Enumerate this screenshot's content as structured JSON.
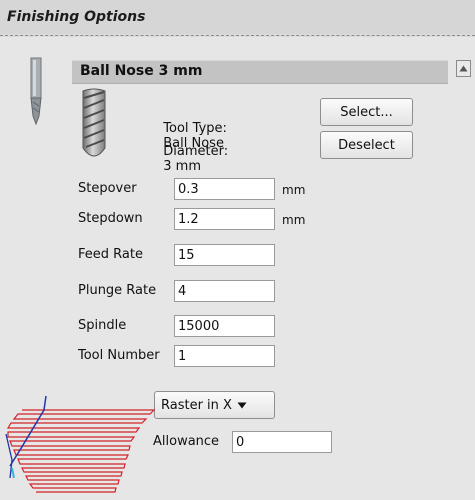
{
  "header": {
    "title": "Finishing Options"
  },
  "tool": {
    "name": "Ball Nose 3 mm",
    "type_label": "Tool Type:",
    "type_value": "Ball Nose",
    "diameter_label": "Diameter:",
    "diameter_value": "3 mm"
  },
  "buttons": {
    "select": "Select...",
    "deselect": "Deselect"
  },
  "fields": [
    {
      "label": "Stepover",
      "value": "0.3",
      "unit": "mm"
    },
    {
      "label": "Stepdown",
      "value": "1.2",
      "unit": "mm"
    },
    {
      "label": "Feed Rate",
      "value": "15"
    },
    {
      "label": "Plunge Rate",
      "value": "4"
    },
    {
      "label": "Spindle",
      "value": "15000"
    },
    {
      "label": "Tool Number",
      "value": "1"
    }
  ],
  "strategy": {
    "selected": "Raster in X"
  },
  "allowance": {
    "label": "Allowance",
    "value": "0"
  },
  "icons": {
    "tool": "end-mill-icon",
    "pencil": "pencil-icon",
    "raster": "raster-toolpath-icon",
    "scroll": "scroll-up-icon"
  },
  "colors": {
    "raster_lines": "#d4232a",
    "axis_blue": "#2136a8",
    "header_bar": "#c3c3c3"
  }
}
